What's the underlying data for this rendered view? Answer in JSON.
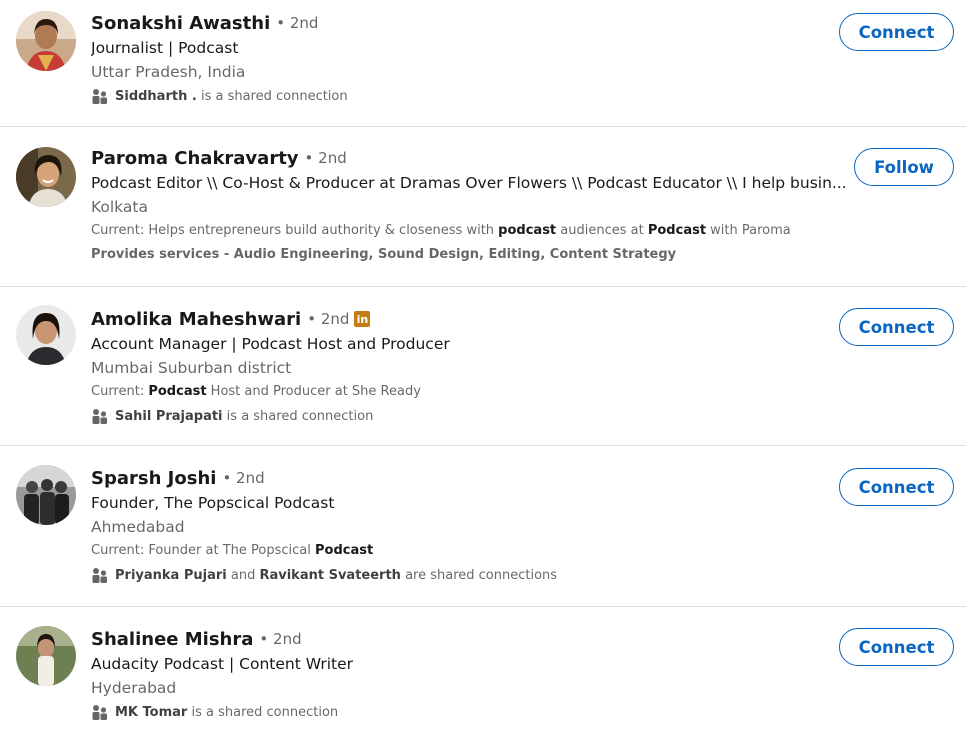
{
  "results": [
    {
      "name": "Sonakshi Awasthi",
      "degree": "• 2nd",
      "headline": "Journalist | Podcast",
      "location": "Uttar Pradesh, India",
      "shared": {
        "people": [
          "Siddharth ."
        ],
        "suffix": "is a shared connection"
      },
      "action": "Connect"
    },
    {
      "name": "Paroma Chakravarty",
      "degree": "• 2nd",
      "headline": "Podcast Editor \\\\ Co-Host & Producer at Dramas Over Flowers \\\\ Podcast Educator \\\\ I help busin...",
      "location": "Kolkata",
      "current": {
        "prefix": "Current: Helps entrepreneurs build authority & closeness with ",
        "highlight1": "podcast",
        "middle": " audiences at ",
        "highlight2": "Podcast",
        "suffix": " with Paroma"
      },
      "services": "Provides services - Audio Engineering, Sound Design, Editing, Content Strategy",
      "action": "Follow"
    },
    {
      "name": "Amolika Maheshwari",
      "degree": "• 2nd",
      "badge": "in",
      "headline": "Account Manager | Podcast Host and Producer",
      "location": "Mumbai Suburban district",
      "current": {
        "prefix": "Current: ",
        "highlight1": "Podcast",
        "suffix": " Host and Producer at She Ready"
      },
      "shared": {
        "people": [
          "Sahil Prajapati"
        ],
        "suffix": "is a shared connection"
      },
      "action": "Connect"
    },
    {
      "name": "Sparsh Joshi",
      "degree": "• 2nd",
      "headline": "Founder, The Popscical Podcast",
      "location": "Ahmedabad",
      "current": {
        "prefix": "Current: Founder at The Popscical ",
        "highlight1": "Podcast",
        "suffix": ""
      },
      "shared": {
        "people": [
          "Priyanka Pujari",
          "Ravikant Svateerth"
        ],
        "joiner": "and",
        "suffix": "are shared connections"
      },
      "action": "Connect"
    },
    {
      "name": "Shalinee Mishra",
      "degree": "• 2nd",
      "headline": "Audacity Podcast | Content Writer",
      "location": "Hyderabad",
      "shared": {
        "people": [
          "MK Tomar"
        ],
        "suffix": "is a shared connection"
      },
      "action": "Connect"
    }
  ],
  "colors": {
    "accent": "#0a66c2",
    "badge": "#c37d16",
    "divider": "#e0e0e0"
  }
}
